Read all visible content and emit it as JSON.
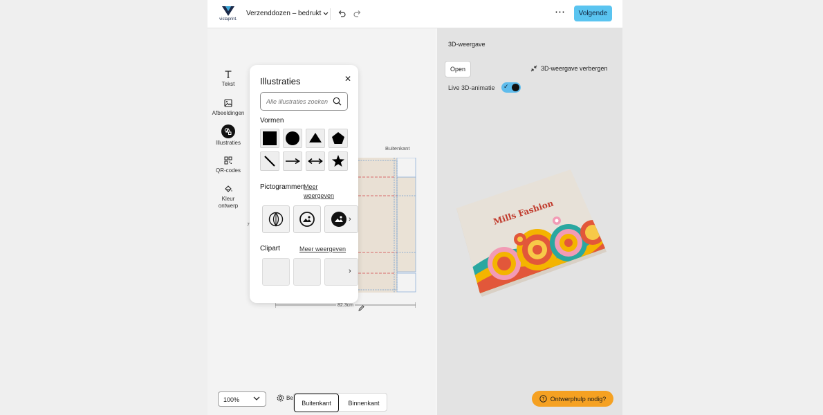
{
  "brand": {
    "logo_text": "vistaprint.",
    "accent": "#5ac4f0"
  },
  "header": {
    "doc_title": "Verzenddozen – bedrukt",
    "next_label": "Volgende"
  },
  "toolbar": [
    {
      "label": "Tekst",
      "icon": "text-icon"
    },
    {
      "label": "Afbeeldingen",
      "icon": "image-icon"
    },
    {
      "label": "Illustraties",
      "icon": "illustrations-icon",
      "active": true
    },
    {
      "label": "QR-codes",
      "icon": "qr-code-icon"
    },
    {
      "label": "Kleur ontwerp",
      "icon": "paint-bucket-icon"
    }
  ],
  "panel": {
    "title": "Illustraties",
    "search_placeholder": "Alle illustraties zoeken",
    "shapes_title": "Vormen",
    "shapes": [
      "square",
      "circle",
      "triangle",
      "pentagon",
      "line",
      "arrow",
      "double-arrow",
      "star"
    ],
    "pictograms_title": "Pictogrammen",
    "pictograms_link": "Meer weergeven",
    "pictograms": [
      "leaf-icon",
      "mountain-photo-icon",
      "mountain-photo-filled-icon"
    ],
    "clipart_title": "Clipart",
    "clipart_link": "Meer weergeven"
  },
  "canvas": {
    "side_label": "Buitenkant",
    "width_dimension": "82.3cm",
    "left_marker": "7"
  },
  "bottom": {
    "zoom": "100%",
    "settings_label": "Be",
    "sides": [
      "Buitenkant",
      "Binnenkant"
    ],
    "active_side": "Buitenkant"
  },
  "view3d": {
    "title": "3D-weergave",
    "open_label": "Open",
    "hide_label": "3D-weergave verbergen",
    "live_label": "Live 3D-animatie",
    "live_on": true,
    "box_text": "Mills Fashion",
    "help_label": "Ontwerphulp nodig?",
    "help_color": "#f5a122"
  }
}
